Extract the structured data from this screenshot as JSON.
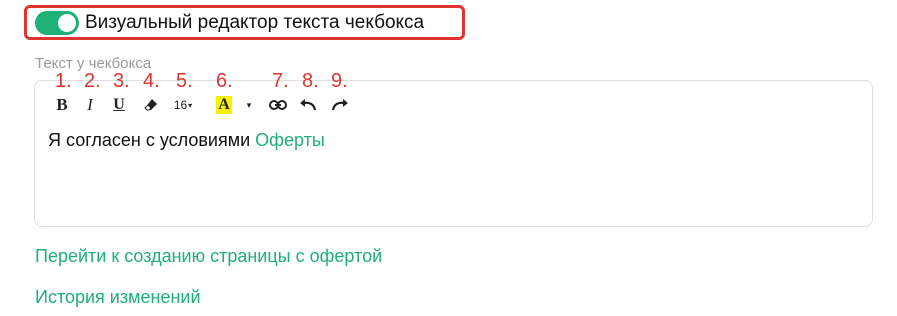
{
  "toggle": {
    "label": "Визуальный редактор текста чекбокса",
    "state": "on",
    "accent_color": "#1db077",
    "highlight_color": "#e0342f"
  },
  "field": {
    "label": "Текст у чекбокса"
  },
  "annotations": [
    "1.",
    "2.",
    "3.",
    "4.",
    "5.",
    "6.",
    "7.",
    "8.",
    "9."
  ],
  "toolbar": {
    "bold": "B",
    "italic": "I",
    "underline": "U",
    "clear_format_icon": "eraser-icon",
    "font_size": "16",
    "font_size_caret": "▾",
    "text_color": "A",
    "text_color_swatch": "#f7f200",
    "text_color_caret": "▾",
    "link_icon": "link-icon",
    "undo_icon": "undo-icon",
    "redo_icon": "redo-icon"
  },
  "editor": {
    "text": "Я согласен с условиями ",
    "link_text": "Оферты"
  },
  "links": {
    "create_offer_page": "Перейти к созданию страницы с офертой",
    "history": "История изменений"
  }
}
